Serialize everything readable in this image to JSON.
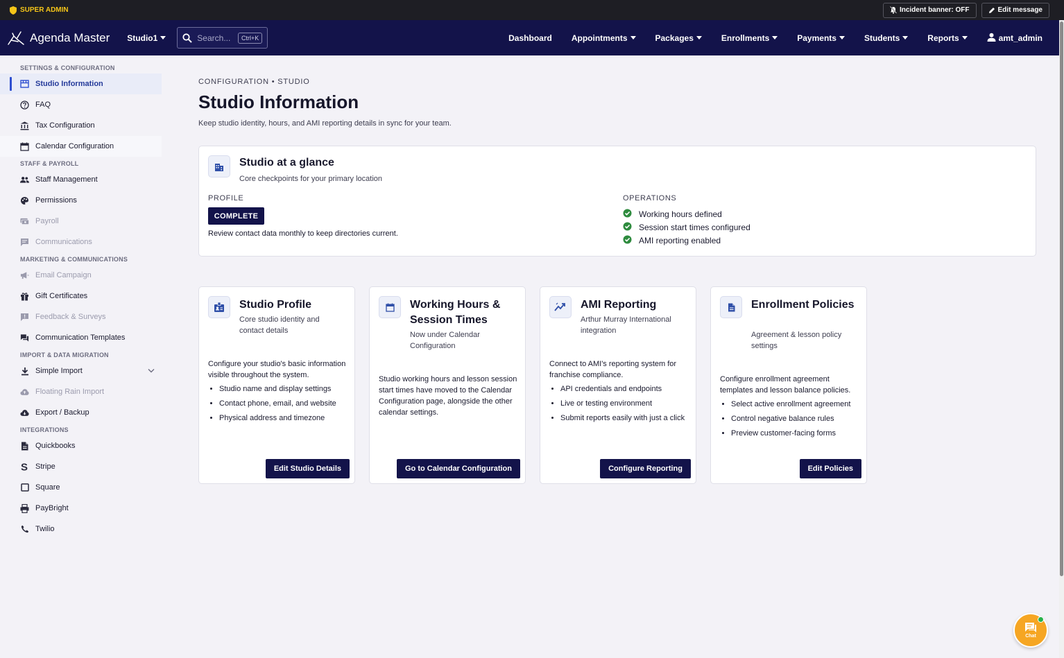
{
  "admin_bar": {
    "badge": "SUPER ADMIN",
    "incident_btn": "Incident banner: OFF",
    "edit_msg_btn": "Edit message"
  },
  "topnav": {
    "brand": "Agenda Master",
    "studio": "Studio1",
    "search_placeholder": "Search...",
    "search_shortcut": "Ctrl+K",
    "links": [
      {
        "label": "Dashboard",
        "caret": false
      },
      {
        "label": "Appointments",
        "caret": true
      },
      {
        "label": "Packages",
        "caret": true
      },
      {
        "label": "Enrollments",
        "caret": true
      },
      {
        "label": "Payments",
        "caret": true
      },
      {
        "label": "Students",
        "caret": true
      },
      {
        "label": "Reports",
        "caret": true
      }
    ],
    "user": "amt_admin"
  },
  "sidebar": {
    "sections": [
      {
        "title": "SETTINGS & CONFIGURATION",
        "items": [
          {
            "label": "Studio Information",
            "icon": "storefront-icon",
            "state": "active"
          },
          {
            "label": "FAQ",
            "icon": "help-circle-icon",
            "state": ""
          },
          {
            "label": "Tax Configuration",
            "icon": "bank-icon",
            "state": ""
          },
          {
            "label": "Calendar Configuration",
            "icon": "calendar-icon",
            "state": "light"
          }
        ]
      },
      {
        "title": "STAFF & PAYROLL",
        "items": [
          {
            "label": "Staff Management",
            "icon": "people-icon",
            "state": ""
          },
          {
            "label": "Permissions",
            "icon": "palette-icon",
            "state": ""
          },
          {
            "label": "Payroll",
            "icon": "payments-icon",
            "state": "disabled"
          },
          {
            "label": "Communications",
            "icon": "message-icon",
            "state": "disabled"
          }
        ]
      },
      {
        "title": "MARKETING & COMMUNICATIONS",
        "items": [
          {
            "label": "Email Campaign",
            "icon": "megaphone-icon",
            "state": "disabled"
          },
          {
            "label": "Gift Certificates",
            "icon": "gift-icon",
            "state": ""
          },
          {
            "label": "Feedback & Surveys",
            "icon": "feedback-icon",
            "state": "disabled"
          },
          {
            "label": "Communication Templates",
            "icon": "forum-icon",
            "state": ""
          }
        ]
      },
      {
        "title": "IMPORT & DATA MIGRATION",
        "items": [
          {
            "label": "Simple Import",
            "icon": "download-icon",
            "state": "",
            "chevron": true
          },
          {
            "label": "Floating Rain Import",
            "icon": "cloud-upload-icon",
            "state": "disabled"
          },
          {
            "label": "Export / Backup",
            "icon": "cloud-download-icon",
            "state": ""
          }
        ]
      },
      {
        "title": "INTEGRATIONS",
        "items": [
          {
            "label": "Quickbooks",
            "icon": "document-icon",
            "state": ""
          },
          {
            "label": "Stripe",
            "icon": "stripe-s-icon",
            "state": ""
          },
          {
            "label": "Square",
            "icon": "square-icon",
            "state": ""
          },
          {
            "label": "PayBright",
            "icon": "printer-icon",
            "state": ""
          },
          {
            "label": "Twilio",
            "icon": "phone-icon",
            "state": ""
          }
        ]
      }
    ]
  },
  "main": {
    "breadcrumb": "CONFIGURATION • STUDIO",
    "title": "Studio Information",
    "subtitle": "Keep studio identity, hours, and AMI reporting details in sync for your team.",
    "glance": {
      "title": "Studio at a glance",
      "subtitle": "Core checkpoints for your primary location",
      "profile_label": "PROFILE",
      "profile_status": "COMPLETE",
      "profile_note": "Review contact data monthly to keep directories current.",
      "operations_label": "OPERATIONS",
      "operations": [
        "Working hours defined",
        "Session start times configured",
        "AMI reporting enabled"
      ]
    },
    "cards": [
      {
        "icon": "badge-icon",
        "title": "Studio Profile",
        "subtitle": "Core studio identity and contact details",
        "body": "Configure your studio's basic information visible throughout the system.",
        "bullets": [
          "Studio name and display settings",
          "Contact phone, email, and website",
          "Physical address and timezone"
        ],
        "button": "Edit Studio Details"
      },
      {
        "icon": "calendar-icon",
        "title": "Working Hours & Session Times",
        "subtitle": "Now under Calendar Configuration",
        "body": "Studio working hours and lesson session start times have moved to the Calendar Configuration page, alongside the other calendar settings.",
        "bullets": [],
        "button": "Go to Calendar Configuration"
      },
      {
        "icon": "trending-up-icon",
        "title": "AMI Reporting",
        "subtitle": "Arthur Murray International integration",
        "body": "Connect to AMI's reporting system for franchise compliance.",
        "bullets": [
          "API credentials and endpoints",
          "Live or testing environment",
          "Submit reports easily with just a click"
        ],
        "button": "Configure Reporting"
      },
      {
        "icon": "document-icon",
        "title": "Enrollment Policies",
        "subtitle": "Agreement & lesson policy settings",
        "body": "Configure enrollment agreement templates and lesson balance policies.",
        "bullets": [
          "Select active enrollment agreement",
          "Control negative balance rules",
          "Preview customer-facing forms"
        ],
        "button": "Edit Policies"
      }
    ]
  },
  "chat": {
    "label": "Chat"
  }
}
